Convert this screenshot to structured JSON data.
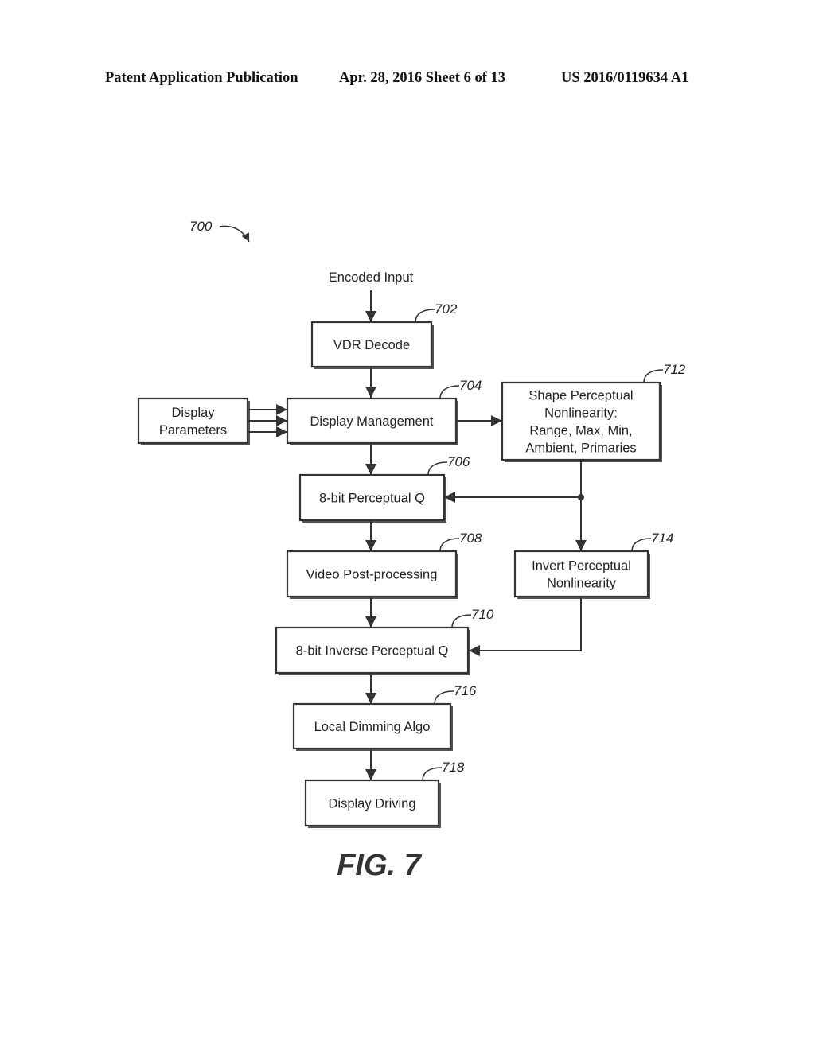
{
  "header": {
    "left": "Patent Application Publication",
    "middle": "Apr. 28, 2016  Sheet 6 of 13",
    "right": "US 2016/0119634 A1"
  },
  "diagram": {
    "figure_ref": "700",
    "input_label": "Encoded Input",
    "figure_caption": "FIG. 7",
    "blocks": [
      {
        "id": "702",
        "ref": "702",
        "lines": [
          "VDR Decode"
        ]
      },
      {
        "id": "704",
        "ref": "704",
        "lines": [
          "Display Management"
        ]
      },
      {
        "id": "display-params",
        "ref": "",
        "lines": [
          "Display",
          "Parameters"
        ]
      },
      {
        "id": "712",
        "ref": "712",
        "lines": [
          "Shape Perceptual",
          "Nonlinearity:",
          "Range, Max, Min,",
          "Ambient, Primaries"
        ]
      },
      {
        "id": "706",
        "ref": "706",
        "lines": [
          "8-bit Perceptual Q"
        ]
      },
      {
        "id": "708",
        "ref": "708",
        "lines": [
          "Video Post-processing"
        ]
      },
      {
        "id": "714",
        "ref": "714",
        "lines": [
          "Invert Perceptual",
          "Nonlinearity"
        ]
      },
      {
        "id": "710",
        "ref": "710",
        "lines": [
          "8-bit Inverse Perceptual Q"
        ]
      },
      {
        "id": "716",
        "ref": "716",
        "lines": [
          "Local Dimming Algo"
        ]
      },
      {
        "id": "718",
        "ref": "718",
        "lines": [
          "Display Driving"
        ]
      }
    ],
    "edges": [
      {
        "from": "input",
        "to": "702"
      },
      {
        "from": "702",
        "to": "704"
      },
      {
        "from": "display-params",
        "to": "704",
        "count": 3
      },
      {
        "from": "704",
        "to": "712"
      },
      {
        "from": "704",
        "to": "706"
      },
      {
        "from": "712",
        "to": "706"
      },
      {
        "from": "712",
        "to": "714"
      },
      {
        "from": "706",
        "to": "708"
      },
      {
        "from": "708",
        "to": "710"
      },
      {
        "from": "714",
        "to": "710"
      },
      {
        "from": "710",
        "to": "716"
      },
      {
        "from": "716",
        "to": "718"
      }
    ]
  }
}
